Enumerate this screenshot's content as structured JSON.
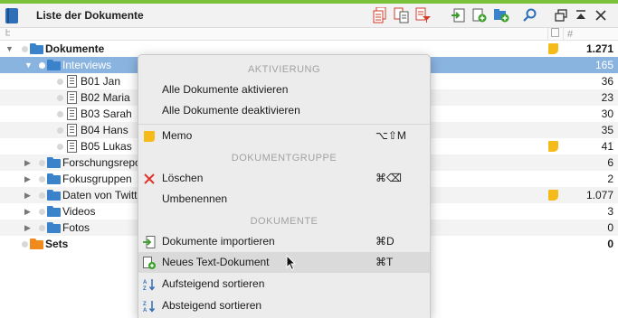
{
  "window": {
    "title": "Liste der Dokumente"
  },
  "colors": {
    "accent_bar": "#7ac23a",
    "folder": "#3a82c9",
    "set_folder": "#f08a1c",
    "memo": "#f5bb1a",
    "selection": "#8ab4e0",
    "delete": "#e0342b"
  },
  "tree": [
    {
      "label": "Dokumente",
      "count": "1.271",
      "bold": true,
      "memo": true
    },
    {
      "label": "Interviews",
      "count": "165",
      "selected": true
    },
    {
      "label": "B01 Jan",
      "count": "36"
    },
    {
      "label": "B02 Maria",
      "count": "23"
    },
    {
      "label": "B03 Sarah",
      "count": "30"
    },
    {
      "label": "B04 Hans",
      "count": "35"
    },
    {
      "label": "B05 Lukas",
      "count": "41",
      "memo": true
    },
    {
      "label": "Forschungsrepo",
      "count": "6"
    },
    {
      "label": "Fokusgruppen",
      "count": "2"
    },
    {
      "label": "Daten von Twitt",
      "count": "1.077",
      "memo": true
    },
    {
      "label": "Videos",
      "count": "3"
    },
    {
      "label": "Fotos",
      "count": "0"
    },
    {
      "label": "Sets",
      "count": "0",
      "bold": true
    }
  ],
  "context_menu": {
    "section_activation": "AKTIVIERUNG",
    "activate_all": "Alle Dokumente aktivieren",
    "deactivate_all": "Alle Dokumente deaktivieren",
    "memo": {
      "label": "Memo",
      "shortcut": "⌥⇧M"
    },
    "section_group": "DOKUMENTGRUPPE",
    "delete": {
      "label": "Löschen",
      "shortcut": "⌘⌫"
    },
    "rename": "Umbenennen",
    "section_documents": "DOKUMENTE",
    "import": {
      "label": "Dokumente importieren",
      "shortcut": "⌘D"
    },
    "new_text": {
      "label": "Neues Text-Dokument",
      "shortcut": "⌘T"
    },
    "sort_asc": "Aufsteigend sortieren",
    "sort_desc": "Absteigend sortieren"
  },
  "icons": {
    "toolbar": [
      "documents-stack-icon",
      "copy-documents-icon",
      "filter-documents-icon",
      "import-icon",
      "new-document-icon",
      "new-group-icon",
      "search-icon",
      "undock-icon",
      "collapse-up-icon",
      "close-icon"
    ]
  }
}
